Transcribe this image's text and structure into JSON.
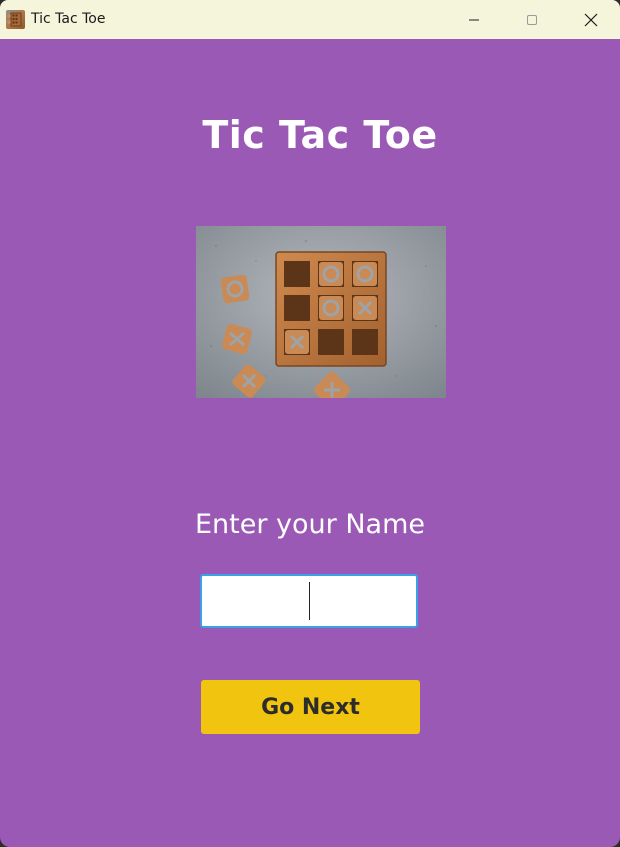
{
  "window": {
    "title": "Tic Tac Toe",
    "icon": "tic-tac-toe-app-icon"
  },
  "titlebar_buttons": {
    "minimize_icon": "minimize-icon",
    "maximize_icon": "maximize-icon",
    "close_icon": "close-icon"
  },
  "main": {
    "heading": "Tic Tac Toe",
    "image": "wooden-tic-tac-toe-board-photo",
    "name_label": "Enter your Name",
    "name_input_value": "",
    "go_next_label": "Go Next"
  },
  "colors": {
    "background": "#9b59b6",
    "titlebar": "#f5f5dc",
    "button": "#f1c40f",
    "input_border": "#3aa0e8"
  }
}
